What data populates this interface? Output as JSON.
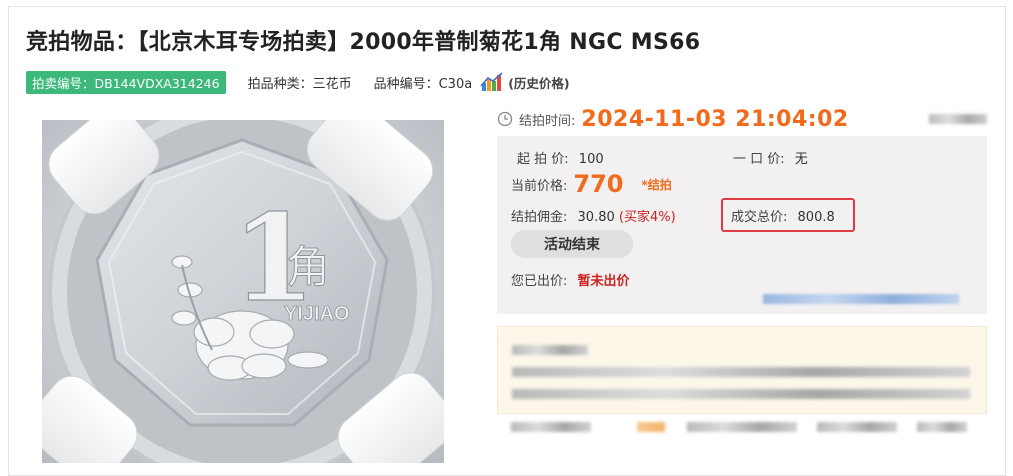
{
  "title": "竞拍物品：【北京木耳专场拍卖】2000年普制菊花1角 NGC MS66",
  "meta": {
    "lot_no": "拍卖编号：DB144VDXA314246",
    "category": "拍品种类：三花币",
    "variety_no": "品种编号：C30a",
    "history_label": "(历史价格)",
    "history_icon": "bar-chart-icon"
  },
  "coin_image": {
    "denomination": "1",
    "unit": "角",
    "pinyin": "YIJIAO"
  },
  "auction": {
    "end_time_label": "结拍时间:",
    "end_time": "2024-11-03 21:04:02",
    "start_price_label": "起 拍 价:",
    "start_price": "100",
    "buy_now_label": "一 口 价:",
    "buy_now": "无",
    "current_price_label": "当前价格:",
    "current_price": "770",
    "current_tag": "*结拍",
    "commission_label": "结拍佣金:",
    "commission": "30.80",
    "commission_note": "(买家4%)",
    "total_label": "成交总价:",
    "total": "800.8",
    "status_button": "活动结束",
    "your_bid_label": "您已出价:",
    "your_bid": "暂未出价"
  },
  "colors": {
    "accent": "#f26a1b",
    "badge": "#3bb87a",
    "highlight_border": "#e23b48",
    "red_text": "#d0201f"
  }
}
